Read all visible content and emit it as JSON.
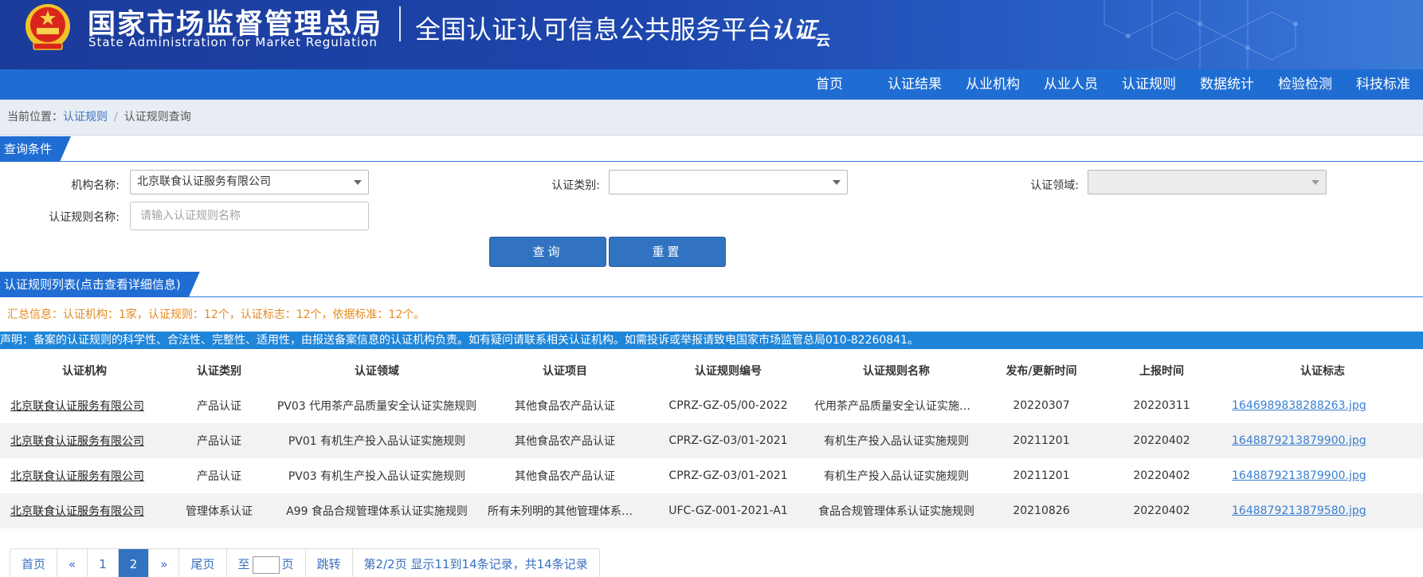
{
  "header": {
    "agency_cn": "国家市场监督管理总局",
    "agency_en": "State Administration  for  Market Regulation",
    "platform_title": "全国认证认可信息公共服务平台",
    "cloud_logo_text": "认证",
    "cloud_logo_sub": "云"
  },
  "nav": [
    "首页",
    "认证结果",
    "从业机构",
    "从业人员",
    "认证规则",
    "数据统计",
    "检验检测",
    "科技标准"
  ],
  "breadcrumb": {
    "prefix": "当前位置：",
    "level1": "认证规则",
    "separator": "/",
    "level2": "认证规则查询"
  },
  "query": {
    "section_title": "查询条件",
    "org_label": "机构名称:",
    "org_value": "北京联食认证服务有限公司",
    "type_label": "认证类别:",
    "type_value": "",
    "field_label": "认证领域:",
    "field_value": "",
    "rule_name_label": "认证规则名称:",
    "rule_name_placeholder": "请输入认证规则名称",
    "search_button": "查询",
    "reset_button": "重置"
  },
  "list": {
    "section_title": "认证规则列表(点击查看详细信息)",
    "summary": "汇总信息：认证机构：1家，认证规则：12个，认证标志：12个，依据标准：12个。",
    "notice": "声明：备案的认证规则的科学性、合法性、完整性、适用性，由报送备案信息的认证机构负责。如有疑问请联系相关认证机构。如需投诉或举报请致电国家市场监管总局010-82260841。",
    "columns": [
      "认证机构",
      "认证类别",
      "认证领域",
      "认证项目",
      "认证规则编号",
      "认证规则名称",
      "发布/更新时间",
      "上报时间",
      "认证标志"
    ],
    "rows": [
      {
        "org": "北京联食认证服务有限公司",
        "type": "产品认证",
        "field": "PV03 代用茶产品质量安全认证实施规则",
        "project": "其他食品农产品认证",
        "code": "CPRZ-GZ-05/00-2022",
        "name": "代用茶产品质量安全认证实施规则",
        "published": "20220307",
        "reported": "20220311",
        "mark": "1646989838288263.jpg"
      },
      {
        "org": "北京联食认证服务有限公司",
        "type": "产品认证",
        "field": "PV01 有机生产投入品认证实施规则",
        "project": "其他食品农产品认证",
        "code": "CPRZ-GZ-03/01-2021",
        "name": "有机生产投入品认证实施规则",
        "published": "20211201",
        "reported": "20220402",
        "mark": "1648879213879900.jpg"
      },
      {
        "org": "北京联食认证服务有限公司",
        "type": "产品认证",
        "field": "PV03 有机生产投入品认证实施规则",
        "project": "其他食品农产品认证",
        "code": "CPRZ-GZ-03/01-2021",
        "name": "有机生产投入品认证实施规则",
        "published": "20211201",
        "reported": "20220402",
        "mark": "1648879213879900.jpg"
      },
      {
        "org": "北京联食认证服务有限公司",
        "type": "管理体系认证",
        "field": "A99 食品合规管理体系认证实施规则",
        "project": "所有未列明的其他管理体系认证",
        "code": "UFC-GZ-001-2021-A1",
        "name": "食品合规管理体系认证实施规则",
        "published": "20210826",
        "reported": "20220402",
        "mark": "1648879213879580.jpg"
      }
    ]
  },
  "pagination": {
    "first": "首页",
    "prev": "«",
    "pages": [
      "1",
      "2"
    ],
    "current": "2",
    "next": "»",
    "last": "尾页",
    "goto_prefix": "至",
    "goto_suffix": "页",
    "jump": "跳转",
    "info": "第2/2页  显示11到14条记录，共14条记录"
  },
  "colors": {
    "header_bg": "#1d46ad",
    "nav_bg": "#1f6dd2",
    "notice_bg": "#1f85d8",
    "summary_text": "#e58a1e",
    "button_bg": "#3173c0",
    "link": "#3a7fd0"
  }
}
